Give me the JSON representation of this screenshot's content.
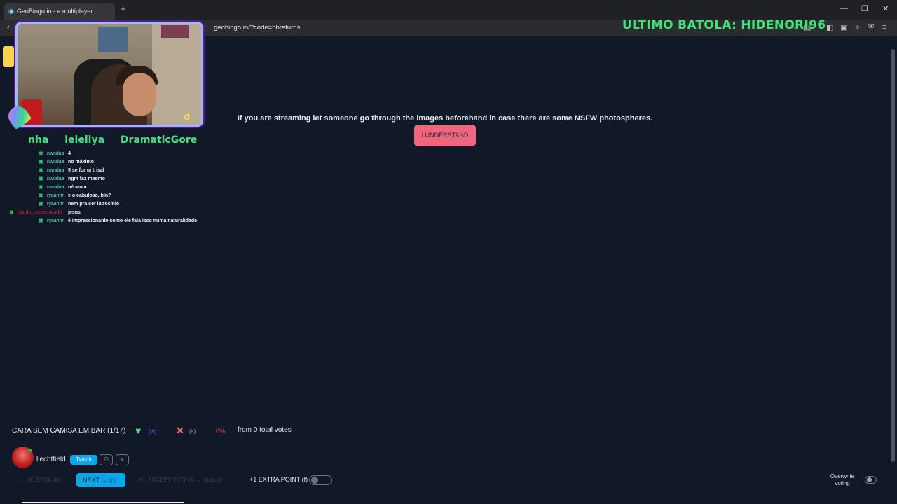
{
  "browser": {
    "tab_title": "GeoBingo.io - a multiplayer",
    "new_tab_icon": "+",
    "url": "geobingo.io/?code=bbreturns",
    "window_controls": [
      "—",
      "❐",
      "✕"
    ]
  },
  "stream_overlay": {
    "title": "ULTIMO BATOLA: HIDENORI96",
    "names": [
      "nha",
      "leleilya",
      "DramaticGore"
    ],
    "cam_mark": "d"
  },
  "chat": [
    {
      "user": "nwndaa",
      "message": "4",
      "badge": "✖",
      "user_color": "#5eead4"
    },
    {
      "user": "nwndaa",
      "message": "no máximo",
      "badge": "✖",
      "user_color": "#5eead4"
    },
    {
      "user": "nwndaa",
      "message": "5 se for uj trisal",
      "badge": "✖",
      "user_color": "#5eead4"
    },
    {
      "user": "nwndaa",
      "message": "ngm faz mesmo",
      "badge": "✖",
      "user_color": "#5eead4"
    },
    {
      "user": "nwndaa",
      "message": "né amor",
      "badge": "✖",
      "user_color": "#5eead4"
    },
    {
      "user": "ryaahhn",
      "message": "e o cabuloso, bin?",
      "badge": "✖",
      "user_color": "#5eead4"
    },
    {
      "user": "ryaahhn",
      "message": "nem pra ser latrocínio",
      "badge": "✖",
      "user_color": "#5eead4"
    },
    {
      "user": "nando_domesticado",
      "message": "jesus",
      "badge": "✖",
      "user_color": "#e11d48"
    },
    {
      "user": "ryaahhn",
      "message": "é impressionante como ele fala isso numa naturalidade",
      "badge": "✖",
      "user_color": "#5eead4"
    }
  ],
  "notice": {
    "text": "If you are streaming let someone go through the images beforehand in case there are some NSFW photospheres.",
    "button": "I UNDERSTAND"
  },
  "voting": {
    "item_label": "CARA SEM CAMISA EM BAR",
    "item_count": "(1/17)",
    "yes_hotkey": "(w)",
    "no_hotkey": "(s)",
    "percent": "0%",
    "total_votes": "from 0 total votes"
  },
  "player": {
    "username": "liechtfield",
    "platform": "Twitch"
  },
  "controls": {
    "go_back": "GO BACK",
    "go_back_hotkey": "(a)",
    "next": "NEXT",
    "next_hotkey": "(d)",
    "accept_voting": "ACCEPT VOTING",
    "accept_hotkey": "(space)",
    "extra_point": "+1 EXTRA POINT (f)",
    "overwrite_voting": "Overwrite voting"
  },
  "colors": {
    "background": "#111827",
    "accent_pink": "#f0667f",
    "accent_blue": "#0ea5e9",
    "overlay_green": "#4ade80"
  }
}
